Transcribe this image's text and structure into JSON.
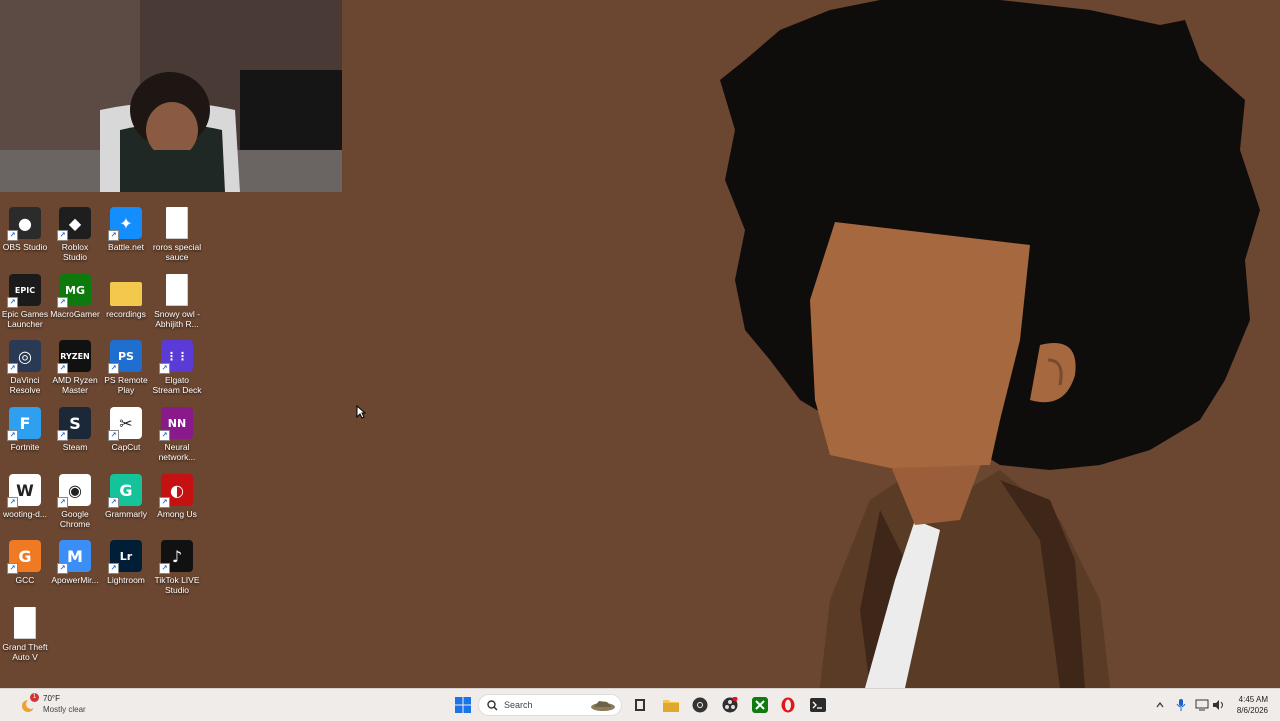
{
  "desktop": {
    "icons": [
      {
        "label": "OBS Studio",
        "icon": "obs-icon",
        "color": "#2b2b2b"
      },
      {
        "label": "Roblox Studio",
        "icon": "roblox-studio-icon",
        "color": "#1e1e1e"
      },
      {
        "label": "Battle.net",
        "icon": "battle-net-icon",
        "color": "#148eff"
      },
      {
        "label": "roros special sauce",
        "icon": "file-icon",
        "color": "#ffffff"
      },
      {
        "label": "Epic Games Launcher",
        "icon": "epic-games-icon",
        "color": "#1b1b1b"
      },
      {
        "label": "MacroGamer",
        "icon": "macrogamer-icon",
        "color": "#0e7a0e"
      },
      {
        "label": "recordings",
        "icon": "folder-icon",
        "color": "#f2c94c"
      },
      {
        "label": "Snowy owl - Abhijith R...",
        "icon": "file-icon",
        "color": "#ffffff"
      },
      {
        "label": "DaVinci Resolve",
        "icon": "davinci-icon",
        "color": "#2a3a55"
      },
      {
        "label": "AMD Ryzen Master",
        "icon": "amd-ryzen-icon",
        "color": "#111111"
      },
      {
        "label": "PS Remote Play",
        "icon": "ps-remote-icon",
        "color": "#1f6fd1"
      },
      {
        "label": "Elgato Stream Deck",
        "icon": "stream-deck-icon",
        "color": "#5b3bd6"
      },
      {
        "label": "Fortnite",
        "icon": "fortnite-icon",
        "color": "#2fa0f0"
      },
      {
        "label": "Steam",
        "icon": "steam-icon",
        "color": "#1b2838"
      },
      {
        "label": "CapCut",
        "icon": "capcut-icon",
        "color": "#ffffff"
      },
      {
        "label": "Neural network...",
        "icon": "neural-network-icon",
        "color": "#8a1a8c"
      },
      {
        "label": "wooting-d...",
        "icon": "wooting-icon",
        "color": "#ffffff"
      },
      {
        "label": "Google Chrome",
        "icon": "chrome-icon",
        "color": "#ffffff"
      },
      {
        "label": "Grammarly",
        "icon": "grammarly-icon",
        "color": "#15c39a"
      },
      {
        "label": "Among Us",
        "icon": "among-us-icon",
        "color": "#c51111"
      },
      {
        "label": "GCC",
        "icon": "gcc-icon",
        "color": "#f07a24"
      },
      {
        "label": "ApowerMir...",
        "icon": "apowermirror-icon",
        "color": "#3c8ef7"
      },
      {
        "label": "Lightroom",
        "icon": "lightroom-icon",
        "color": "#001e36"
      },
      {
        "label": "TikTok LIVE Studio",
        "icon": "tiktok-icon",
        "color": "#111111"
      },
      {
        "label": "Grand Theft Auto V",
        "icon": "file-icon",
        "color": "#ffffff"
      }
    ]
  },
  "taskbar": {
    "weather": {
      "temp": "70°F",
      "desc": "Mostly clear",
      "badge": "1"
    },
    "search_placeholder": "Search",
    "clock": {
      "time": "4:45 AM",
      "date": "8/6/2026"
    },
    "pinned": [
      "task-view-icon",
      "file-explorer-icon",
      "chrome-icon",
      "obs-icon",
      "xbox-icon",
      "opera-icon",
      "terminal-icon"
    ],
    "tray": [
      "chevron-up-icon",
      "microphone-icon",
      "network-icon",
      "volume-icon"
    ]
  },
  "colors": {
    "wallpaper": "#6b4630",
    "hair": "#0f0d0c",
    "skin": "#a6683f",
    "jacket": "#5a3b25",
    "shirt": "#eeeeee",
    "taskbar": "#f0ece9"
  }
}
